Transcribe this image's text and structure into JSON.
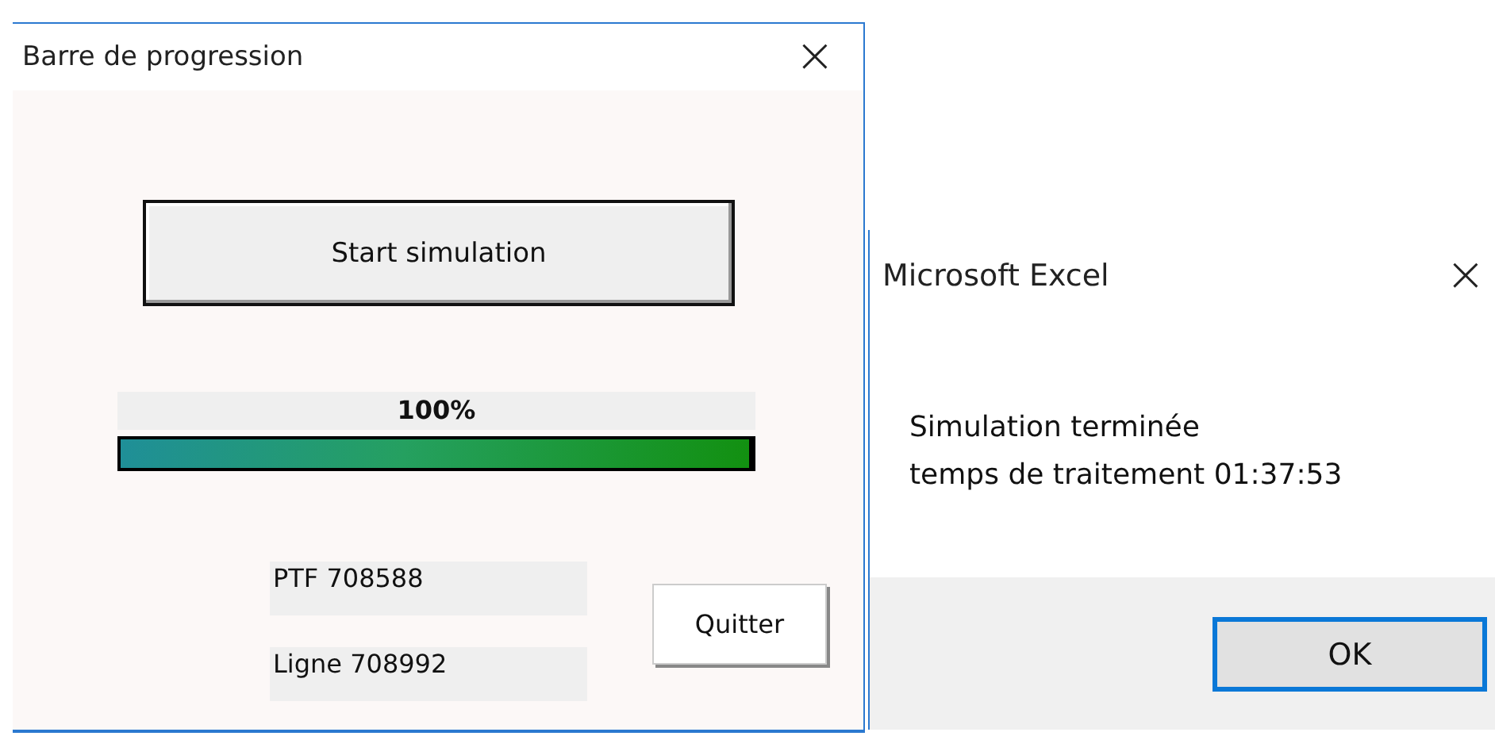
{
  "progress_window": {
    "title": "Barre de progression",
    "close": "×",
    "start_button": "Start simulation",
    "progress": {
      "label": "100%",
      "level": 1.0
    },
    "info_labels": [
      "PTF 708588",
      "Ligne 708992"
    ],
    "quit_button": "Quitter"
  },
  "message_box": {
    "title": "Microsoft Excel",
    "close": "×",
    "lines": [
      "Simulation terminée",
      "temps de traitement 01:37:53"
    ],
    "buttons": [
      {
        "label": "OK",
        "selected": true
      }
    ]
  }
}
